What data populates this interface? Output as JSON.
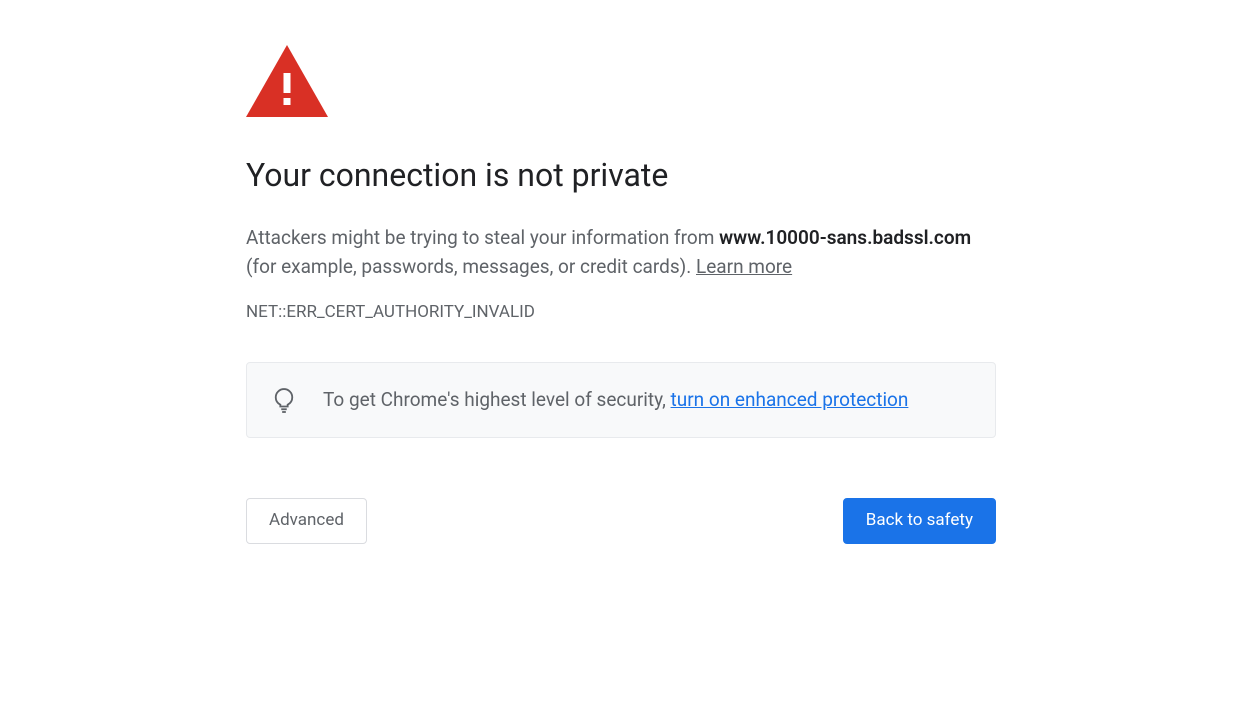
{
  "icon": {
    "warning_color": "#d93025",
    "lightbulb_color": "#5f6368"
  },
  "heading": "Your connection is not private",
  "body": {
    "prefix": "Attackers might be trying to steal your information from ",
    "domain": "www.10000-sans.badssl.com",
    "suffix": " (for example, passwords, messages, or credit cards). ",
    "learn_more": "Learn more"
  },
  "error_code": "NET::ERR_CERT_AUTHORITY_INVALID",
  "info": {
    "text_prefix": "To get Chrome's highest level of security, ",
    "link_text": "turn on enhanced protection"
  },
  "buttons": {
    "advanced": "Advanced",
    "back_to_safety": "Back to safety"
  }
}
